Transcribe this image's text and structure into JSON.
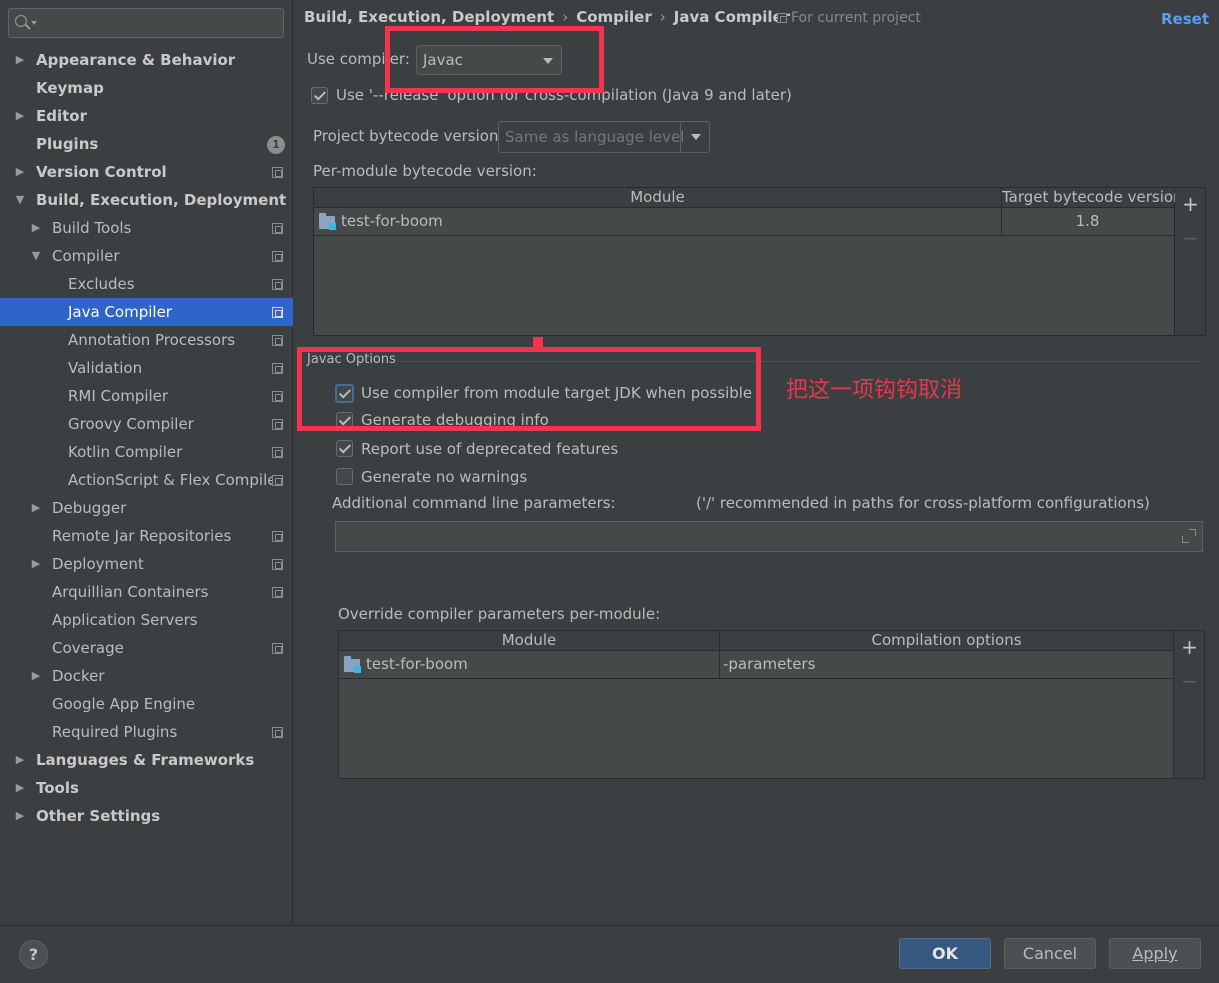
{
  "sidebar": {
    "search_placeholder": "",
    "items": [
      {
        "label": "Appearance & Behavior"
      },
      {
        "label": "Keymap"
      },
      {
        "label": "Editor"
      },
      {
        "label": "Plugins",
        "badge": "1"
      },
      {
        "label": "Version Control"
      },
      {
        "label": "Build, Execution, Deployment"
      },
      {
        "label": "Build Tools"
      },
      {
        "label": "Compiler"
      },
      {
        "label": "Excludes"
      },
      {
        "label": "Java Compiler"
      },
      {
        "label": "Annotation Processors"
      },
      {
        "label": "Validation"
      },
      {
        "label": "RMI Compiler"
      },
      {
        "label": "Groovy Compiler"
      },
      {
        "label": "Kotlin Compiler"
      },
      {
        "label": "ActionScript & Flex Compiler"
      },
      {
        "label": "Debugger"
      },
      {
        "label": "Remote Jar Repositories"
      },
      {
        "label": "Deployment"
      },
      {
        "label": "Arquillian Containers"
      },
      {
        "label": "Application Servers"
      },
      {
        "label": "Coverage"
      },
      {
        "label": "Docker"
      },
      {
        "label": "Google App Engine"
      },
      {
        "label": "Required Plugins"
      },
      {
        "label": "Languages & Frameworks"
      },
      {
        "label": "Tools"
      },
      {
        "label": "Other Settings"
      }
    ]
  },
  "header": {
    "breadcrumb": [
      "Build, Execution, Deployment",
      "Compiler",
      "Java Compiler"
    ],
    "separator": "›",
    "scope": "For current project",
    "reset": "Reset"
  },
  "compiler": {
    "use_compiler_label": "Use compiler:",
    "use_compiler_value": "Javac",
    "release_option": "Use '--release' option for cross-compilation (Java 9 and later)",
    "bytecode_label": "Project bytecode version:",
    "bytecode_value": "Same as language level",
    "per_module_label": "Per-module bytecode version:",
    "per_module_table": {
      "columns": [
        "Module",
        "Target bytecode version"
      ],
      "rows": [
        {
          "module": "test-for-boom",
          "version": "1.8"
        }
      ]
    }
  },
  "javac_options": {
    "title": "Javac Options",
    "options": [
      {
        "label": "Use compiler from module target JDK when possible",
        "checked": true
      },
      {
        "label": "Generate debugging info",
        "checked": true
      },
      {
        "label": "Report use of deprecated features",
        "checked": true
      },
      {
        "label": "Generate no warnings",
        "checked": false
      }
    ],
    "additional_params_label": "Additional command line parameters:",
    "additional_params_hint": "('/' recommended in paths for cross-platform configurations)",
    "additional_params_value": "",
    "override_label": "Override compiler parameters per-module:",
    "override_table": {
      "columns": [
        "Module",
        "Compilation options"
      ],
      "rows": [
        {
          "module": "test-for-boom",
          "options": "-parameters"
        }
      ]
    }
  },
  "annotation": {
    "note": "把这一项钩钩取消",
    "color": "#f4344f"
  },
  "table_tools": {
    "add": "+",
    "remove": "−"
  },
  "footer": {
    "help": "?",
    "ok": "OK",
    "cancel": "Cancel",
    "apply": "Apply"
  },
  "colors": {
    "accent_selected": "#2f65ca",
    "link": "#589df6",
    "primary_button": "#365880",
    "background": "#3c3f41"
  }
}
